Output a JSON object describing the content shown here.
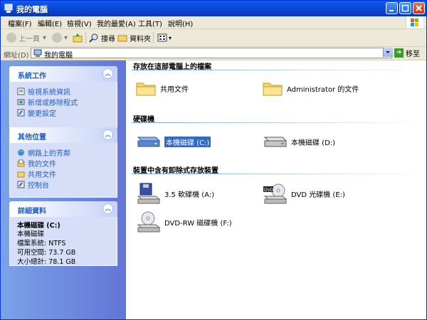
{
  "window": {
    "title": "我的電腦"
  },
  "menu": [
    "檔案(F)",
    "編輯(E)",
    "檢視(V)",
    "我的最愛(A)",
    "工具(T)",
    "說明(H)"
  ],
  "toolbar": {
    "back": "上一頁",
    "search": "搜尋",
    "folders": "資料夾"
  },
  "address": {
    "label": "網址(D)",
    "value": "我的電腦",
    "go": "移至"
  },
  "tasks_panel": {
    "title": "系統工作",
    "items": [
      "檢視系統資訊",
      "新增或移除程式",
      "變更設定"
    ]
  },
  "places_panel": {
    "title": "其他位置",
    "items": [
      "網路上的芳鄰",
      "我的文件",
      "共用文件",
      "控制台"
    ]
  },
  "details_panel": {
    "title": "詳細資料",
    "name": "本機磁碟 (C:)",
    "type": "本機磁碟",
    "fs": "檔案系統: NTFS",
    "free": "可用空間: 73.7 GB",
    "total": "大小總計: 78.1 GB"
  },
  "sections": {
    "files": "存放在這部電腦上的檔案",
    "hdd": "硬碟機",
    "removable": "裝置中含有卸除式存放裝置"
  },
  "files": [
    "共用文件",
    "Administrator 的文件"
  ],
  "drives": [
    "本機磁碟 (C:)",
    "本機磁碟 (D:)"
  ],
  "removable": [
    "3.5 軟碟機 (A:)",
    "DVD 光碟機 (E:)",
    "DVD-RW 磁碟機 (F:)"
  ],
  "colors": {
    "title_bar": "#0a4bd8",
    "task_pane": "#7ba2e7",
    "link": "#215dc6",
    "selection": "#316ac5"
  }
}
